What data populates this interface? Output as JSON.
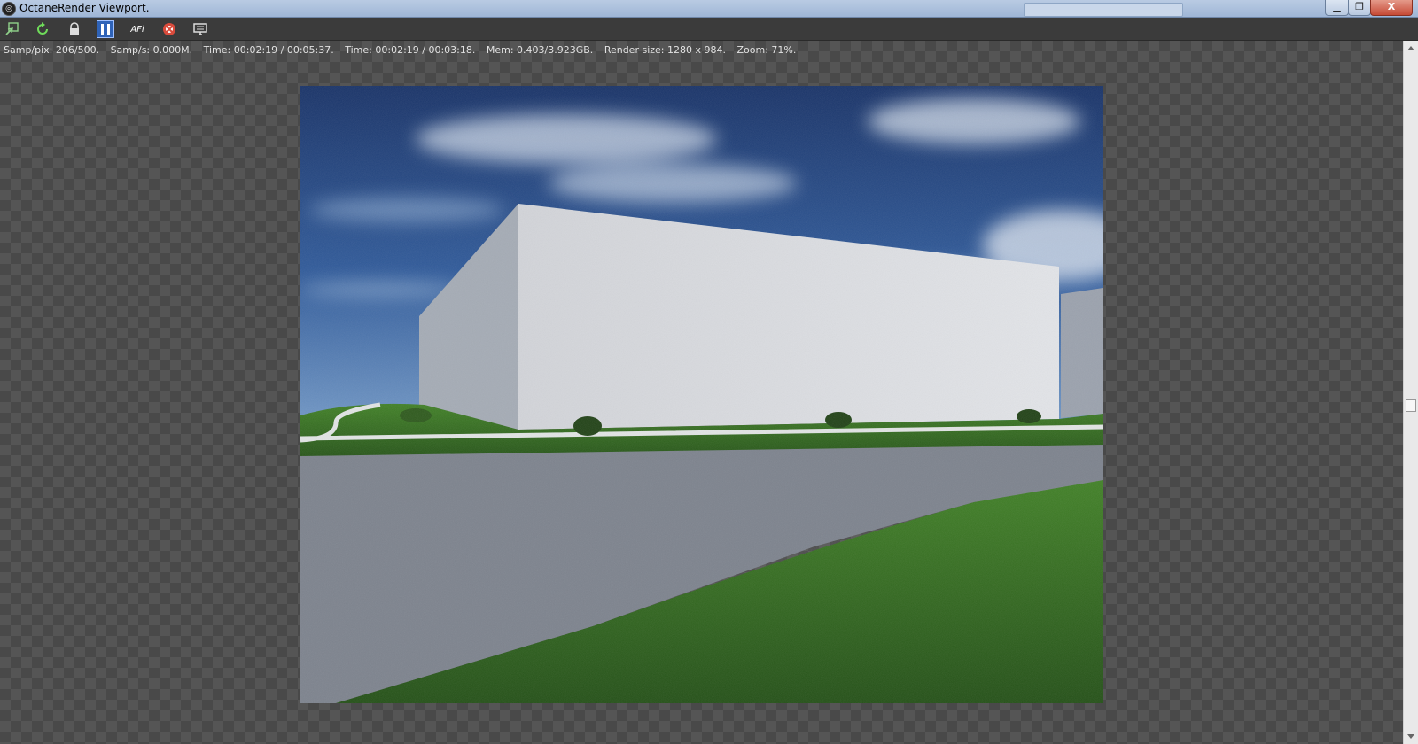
{
  "window": {
    "title": "OctaneRender Viewport.",
    "minimize_label": "▁",
    "maximize_label": "❐",
    "close_label": "X"
  },
  "toolbar": {
    "icons": [
      {
        "name": "send-scene-icon",
        "active": false
      },
      {
        "name": "restart-render-icon",
        "active": false
      },
      {
        "name": "lock-icon",
        "active": false
      },
      {
        "name": "pause-icon",
        "active": true
      },
      {
        "name": "focus-picker-icon",
        "active": false
      },
      {
        "name": "stop-render-icon",
        "active": false
      },
      {
        "name": "display-settings-icon",
        "active": false
      }
    ],
    "afi_label": "AFi"
  },
  "status": {
    "samp_pix": "Samp/pix: 206/500.",
    "samp_s": "Samp/s: 0.000M.",
    "time1": "Time: 00:02:19 / 00:05:37.",
    "time2": "Time: 00:02:19 / 00:03:18.",
    "mem": "Mem: 0.403/3.923GB.",
    "render_size": "Render size: 1280 x 984.",
    "zoom": "Zoom: 71%."
  },
  "colors": {
    "sky_top": "#1b3a73",
    "sky_bottom": "#4d7cb6",
    "wall": "#d6d8dc",
    "wall_side": "#9fa6b0",
    "grass": "#2f6b1c",
    "road": "#7a808a",
    "active_tool": "#2f63b8"
  }
}
